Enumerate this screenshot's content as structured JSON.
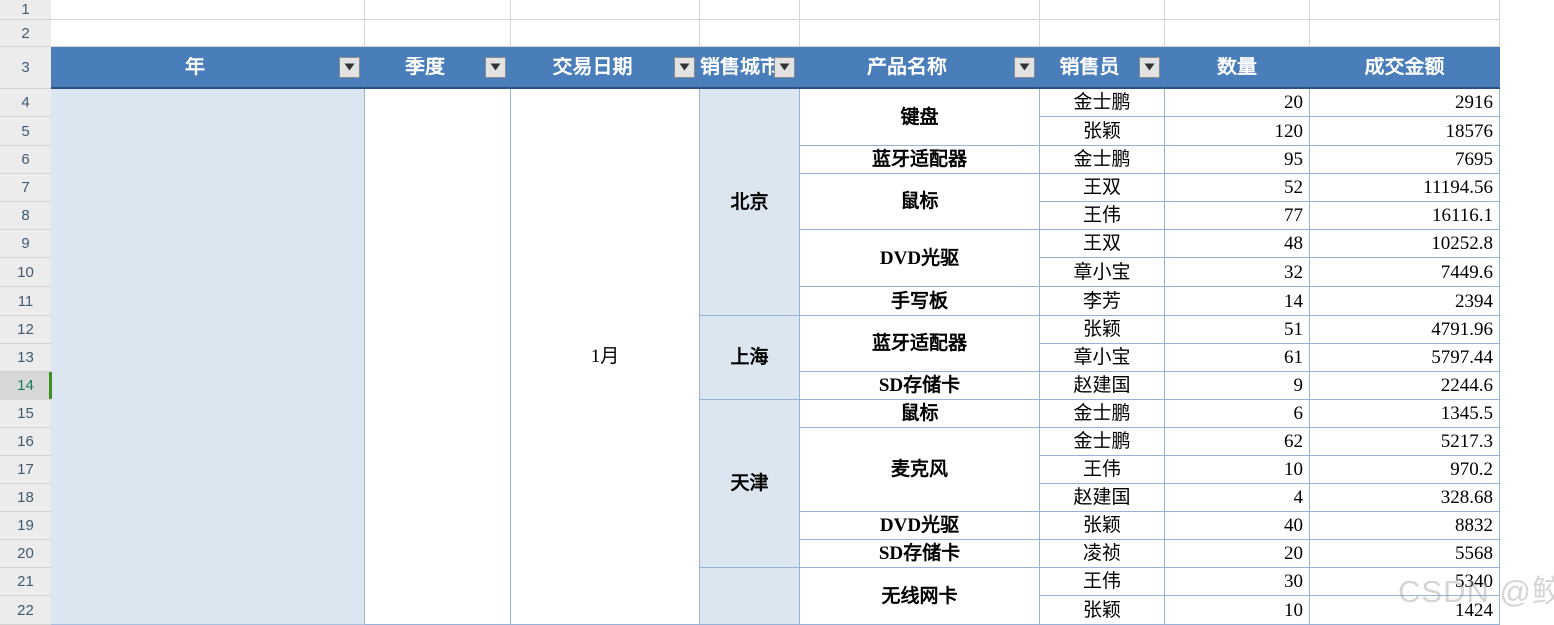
{
  "app": {
    "type": "spreadsheet",
    "active_row": "14"
  },
  "colors": {
    "header_blue": "#4a7ebb",
    "fill_light_blue": "#dce6f1",
    "grid_line": "#95b3d7",
    "gutter": "#ececec",
    "active_marker_green": "#3f9022"
  },
  "row_numbers": [
    "1",
    "2",
    "3",
    "4",
    "5",
    "6",
    "7",
    "8",
    "9",
    "10",
    "11",
    "12",
    "13",
    "14",
    "15",
    "16",
    "17",
    "18",
    "19",
    "20",
    "21",
    "22"
  ],
  "header": {
    "columns": [
      {
        "label": "年",
        "has_filter": true
      },
      {
        "label": "季度",
        "has_filter": true
      },
      {
        "label": "交易日期",
        "has_filter": true
      },
      {
        "label": "销售城市",
        "has_filter": true
      },
      {
        "label": "产品名称",
        "has_filter": true
      },
      {
        "label": "销售员",
        "has_filter": true
      },
      {
        "label": "数量",
        "has_filter": false
      },
      {
        "label": "成交金额",
        "has_filter": false
      }
    ]
  },
  "merged": {
    "year": "",
    "quarter": "",
    "trade_date": "1月"
  },
  "cities": [
    {
      "name": "北京"
    },
    {
      "name": "上海"
    },
    {
      "name": "天津"
    },
    {
      "name": ""
    }
  ],
  "products": [
    {
      "name": "键盘"
    },
    {
      "name": "蓝牙适配器"
    },
    {
      "name": "鼠标"
    },
    {
      "name": "DVD光驱"
    },
    {
      "name": "手写板"
    },
    {
      "name": "蓝牙适配器"
    },
    {
      "name": "SD存储卡"
    },
    {
      "name": "鼠标"
    },
    {
      "name": "麦克风"
    },
    {
      "name": "DVD光驱"
    },
    {
      "name": "SD存储卡"
    },
    {
      "name": "无线网卡"
    }
  ],
  "rows": [
    {
      "row": "4",
      "salesperson": "金士鹏",
      "quantity": "20",
      "amount": "2916"
    },
    {
      "row": "5",
      "salesperson": "张颖",
      "quantity": "120",
      "amount": "18576"
    },
    {
      "row": "6",
      "salesperson": "金士鹏",
      "quantity": "95",
      "amount": "7695"
    },
    {
      "row": "7",
      "salesperson": "王双",
      "quantity": "52",
      "amount": "11194.56"
    },
    {
      "row": "8",
      "salesperson": "王伟",
      "quantity": "77",
      "amount": "16116.1"
    },
    {
      "row": "9",
      "salesperson": "王双",
      "quantity": "48",
      "amount": "10252.8"
    },
    {
      "row": "10",
      "salesperson": "章小宝",
      "quantity": "32",
      "amount": "7449.6"
    },
    {
      "row": "11",
      "salesperson": "李芳",
      "quantity": "14",
      "amount": "2394"
    },
    {
      "row": "12",
      "salesperson": "张颖",
      "quantity": "51",
      "amount": "4791.96"
    },
    {
      "row": "13",
      "salesperson": "章小宝",
      "quantity": "61",
      "amount": "5797.44"
    },
    {
      "row": "14",
      "salesperson": "赵建国",
      "quantity": "9",
      "amount": "2244.6"
    },
    {
      "row": "15",
      "salesperson": "金士鹏",
      "quantity": "6",
      "amount": "1345.5"
    },
    {
      "row": "16",
      "salesperson": "金士鹏",
      "quantity": "62",
      "amount": "5217.3"
    },
    {
      "row": "17",
      "salesperson": "王伟",
      "quantity": "10",
      "amount": "970.2"
    },
    {
      "row": "18",
      "salesperson": "赵建国",
      "quantity": "4",
      "amount": "328.68"
    },
    {
      "row": "19",
      "salesperson": "张颖",
      "quantity": "40",
      "amount": "8832"
    },
    {
      "row": "20",
      "salesperson": "凌祯",
      "quantity": "20",
      "amount": "5568"
    },
    {
      "row": "21",
      "salesperson": "王伟",
      "quantity": "30",
      "amount": "5340"
    },
    {
      "row": "22",
      "salesperson": "张颖",
      "quantity": "10",
      "amount": "1424"
    }
  ],
  "watermark": {
    "text": "CSDN @鲛"
  }
}
